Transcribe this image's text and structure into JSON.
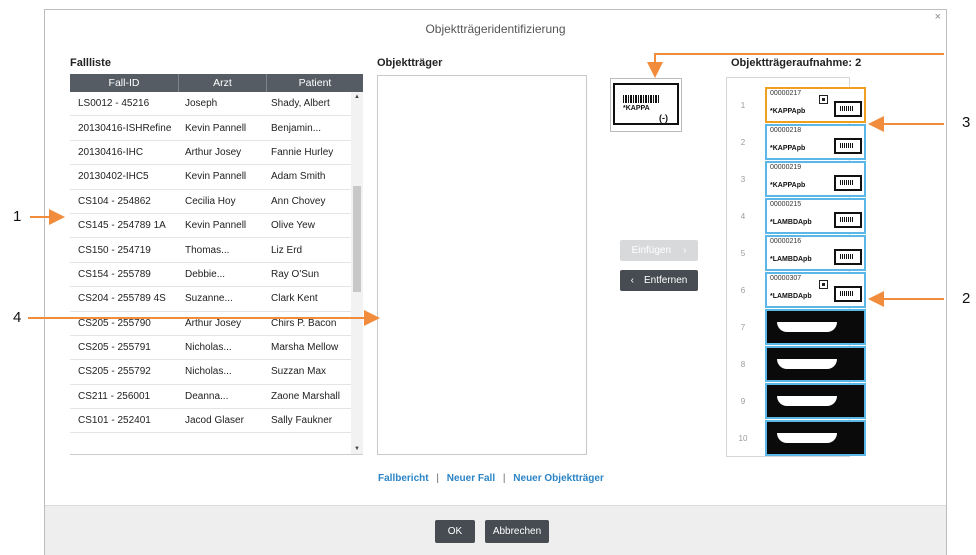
{
  "dialog": {
    "title": "Objektträgeridentifizierung",
    "close": "×"
  },
  "case_list": {
    "label": "Fallliste",
    "headers": [
      "Fall-ID",
      "Arzt",
      "Patient"
    ],
    "rows": [
      [
        "LS0012 - 45216",
        "Joseph",
        "Shady, Albert"
      ],
      [
        "20130416-ISHRefine",
        "Kevin Pannell",
        "Benjamin..."
      ],
      [
        "20130416-IHC",
        "Arthur Josey",
        "Fannie Hurley"
      ],
      [
        "20130402-IHC5",
        "Kevin Pannell",
        "Adam Smith"
      ],
      [
        "CS104 - 254862",
        "Cecilia Hoy",
        "Ann Chovey"
      ],
      [
        "CS145 - 254789 1A",
        "Kevin Pannell",
        "Olive Yew"
      ],
      [
        "CS150 - 254719",
        "Thomas...",
        "Liz Erd"
      ],
      [
        "CS154 - 255789",
        "Debbie...",
        "Ray O'Sun"
      ],
      [
        "CS204 - 255789 4S",
        "Suzanne...",
        "Clark Kent"
      ],
      [
        "CS205 - 255790",
        "Arthur Josey",
        "Chirs P. Bacon"
      ],
      [
        "CS205 - 255791",
        "Nicholas...",
        "Marsha Mellow"
      ],
      [
        "CS205 - 255792",
        "Nicholas...",
        "Suzzan Max"
      ],
      [
        "CS211 - 256001",
        "Deanna...",
        "Zaone Marshall"
      ],
      [
        "CS101 - 252401",
        "Jacod Glaser",
        "Sally Faukner"
      ]
    ]
  },
  "slides": {
    "label": "Objektträger"
  },
  "preview": {
    "marker": "*KAPPA",
    "sign": "(-)"
  },
  "buttons": {
    "insert": "Einfügen",
    "remove": "Entfernen",
    "ok": "OK",
    "cancel": "Abbrechen"
  },
  "capture": {
    "label": "Objektträgeraufnahme: 2",
    "slots": [
      {
        "num": "1",
        "id": "00000217",
        "name": "*KAPPApb",
        "selected": true,
        "qr": true
      },
      {
        "num": "2",
        "id": "00000218",
        "name": "*KAPPApb"
      },
      {
        "num": "3",
        "id": "00000219",
        "name": "*KAPPApb"
      },
      {
        "num": "4",
        "id": "00000215",
        "name": "*LAMBDApb"
      },
      {
        "num": "5",
        "id": "00000216",
        "name": "*LAMBDApb"
      },
      {
        "num": "6",
        "id": "00000307",
        "name": "*LAMBDApb",
        "qr": true
      },
      {
        "num": "7",
        "dark": true
      },
      {
        "num": "8",
        "dark": true
      },
      {
        "num": "9",
        "dark": true
      },
      {
        "num": "10",
        "dark": true
      }
    ]
  },
  "links": {
    "case_report": "Fallbericht",
    "new_case": "Neuer Fall",
    "new_slide": "Neuer Objektträger",
    "separator": "|"
  },
  "callouts": [
    "1",
    "2",
    "3",
    "4"
  ],
  "colors": {
    "accent": "#f08c3c",
    "slot_border": "#5bb7e6",
    "selected_border": "#f0a020",
    "link": "#2b84c6",
    "button_dark": "#474c52"
  }
}
